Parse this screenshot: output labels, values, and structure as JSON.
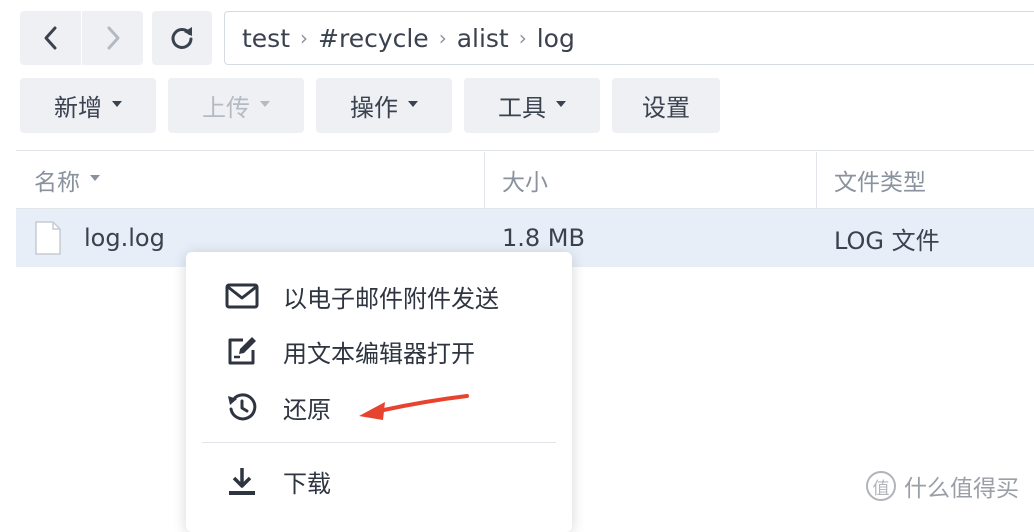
{
  "navigation": {
    "back_icon": "chevron-left-icon",
    "forward_icon": "chevron-right-icon",
    "refresh_icon": "refresh-icon"
  },
  "breadcrumb": {
    "items": [
      "test",
      "#recycle",
      "alist",
      "log"
    ],
    "separator": "›"
  },
  "toolbar": {
    "new_label": "新增",
    "upload_label": "上传",
    "action_label": "操作",
    "tools_label": "工具",
    "settings_label": "设置"
  },
  "table": {
    "columns": [
      "名称",
      "大小",
      "文件类型"
    ],
    "rows": [
      {
        "name": "log.log",
        "size": "1.8 MB",
        "type": "LOG 文件",
        "icon": "file-icon"
      }
    ]
  },
  "context_menu": {
    "items": [
      {
        "label": "以电子邮件附件发送",
        "icon": "mail-icon"
      },
      {
        "label": "用文本编辑器打开",
        "icon": "edit-icon"
      },
      {
        "label": "还原",
        "icon": "restore-icon"
      },
      {
        "label": "下载",
        "icon": "download-icon"
      }
    ]
  },
  "annotation": {
    "arrow_color": "#e8432e"
  },
  "watermark": {
    "text": "什么值得买",
    "logo": "值"
  },
  "colors": {
    "accent_row": "#e7eef8",
    "button_bg": "#eef0f3",
    "text": "#3a4250",
    "muted": "#8a929e"
  }
}
